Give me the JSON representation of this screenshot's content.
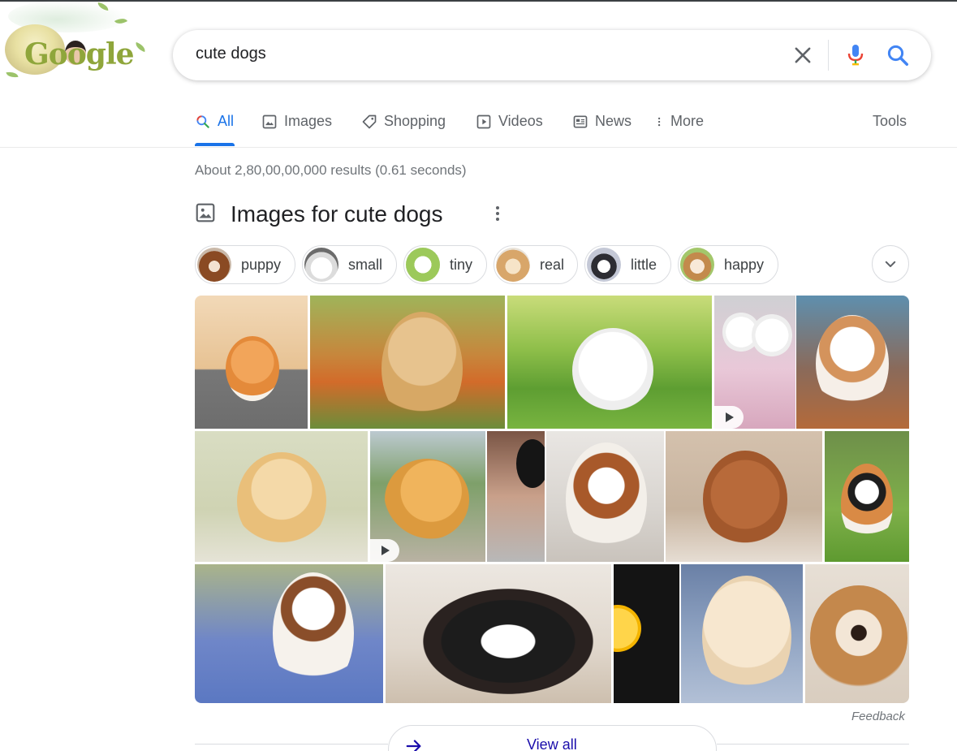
{
  "search": {
    "query": "cute dogs"
  },
  "logo": {
    "text": "Google"
  },
  "tabs": [
    {
      "label": "All",
      "icon": "search-icon",
      "active": true
    },
    {
      "label": "Images",
      "icon": "image-icon"
    },
    {
      "label": "Shopping",
      "icon": "tag-icon"
    },
    {
      "label": "Videos",
      "icon": "play-icon"
    },
    {
      "label": "News",
      "icon": "newspaper-icon"
    },
    {
      "label": "More",
      "icon": "kebab-icon"
    }
  ],
  "tools_label": "Tools",
  "stats": "About 2,80,00,00,000 results (0.61 seconds)",
  "images_section": {
    "title": "Images for cute dogs",
    "chips": [
      {
        "label": "puppy"
      },
      {
        "label": "small"
      },
      {
        "label": "tiny"
      },
      {
        "label": "real"
      },
      {
        "label": "little"
      },
      {
        "label": "happy"
      }
    ]
  },
  "feedback_label": "Feedback",
  "view_all_label": "View all",
  "colors": {
    "accent": "#1a73e8",
    "link": "#1a0dab",
    "muted": "#70757a"
  }
}
